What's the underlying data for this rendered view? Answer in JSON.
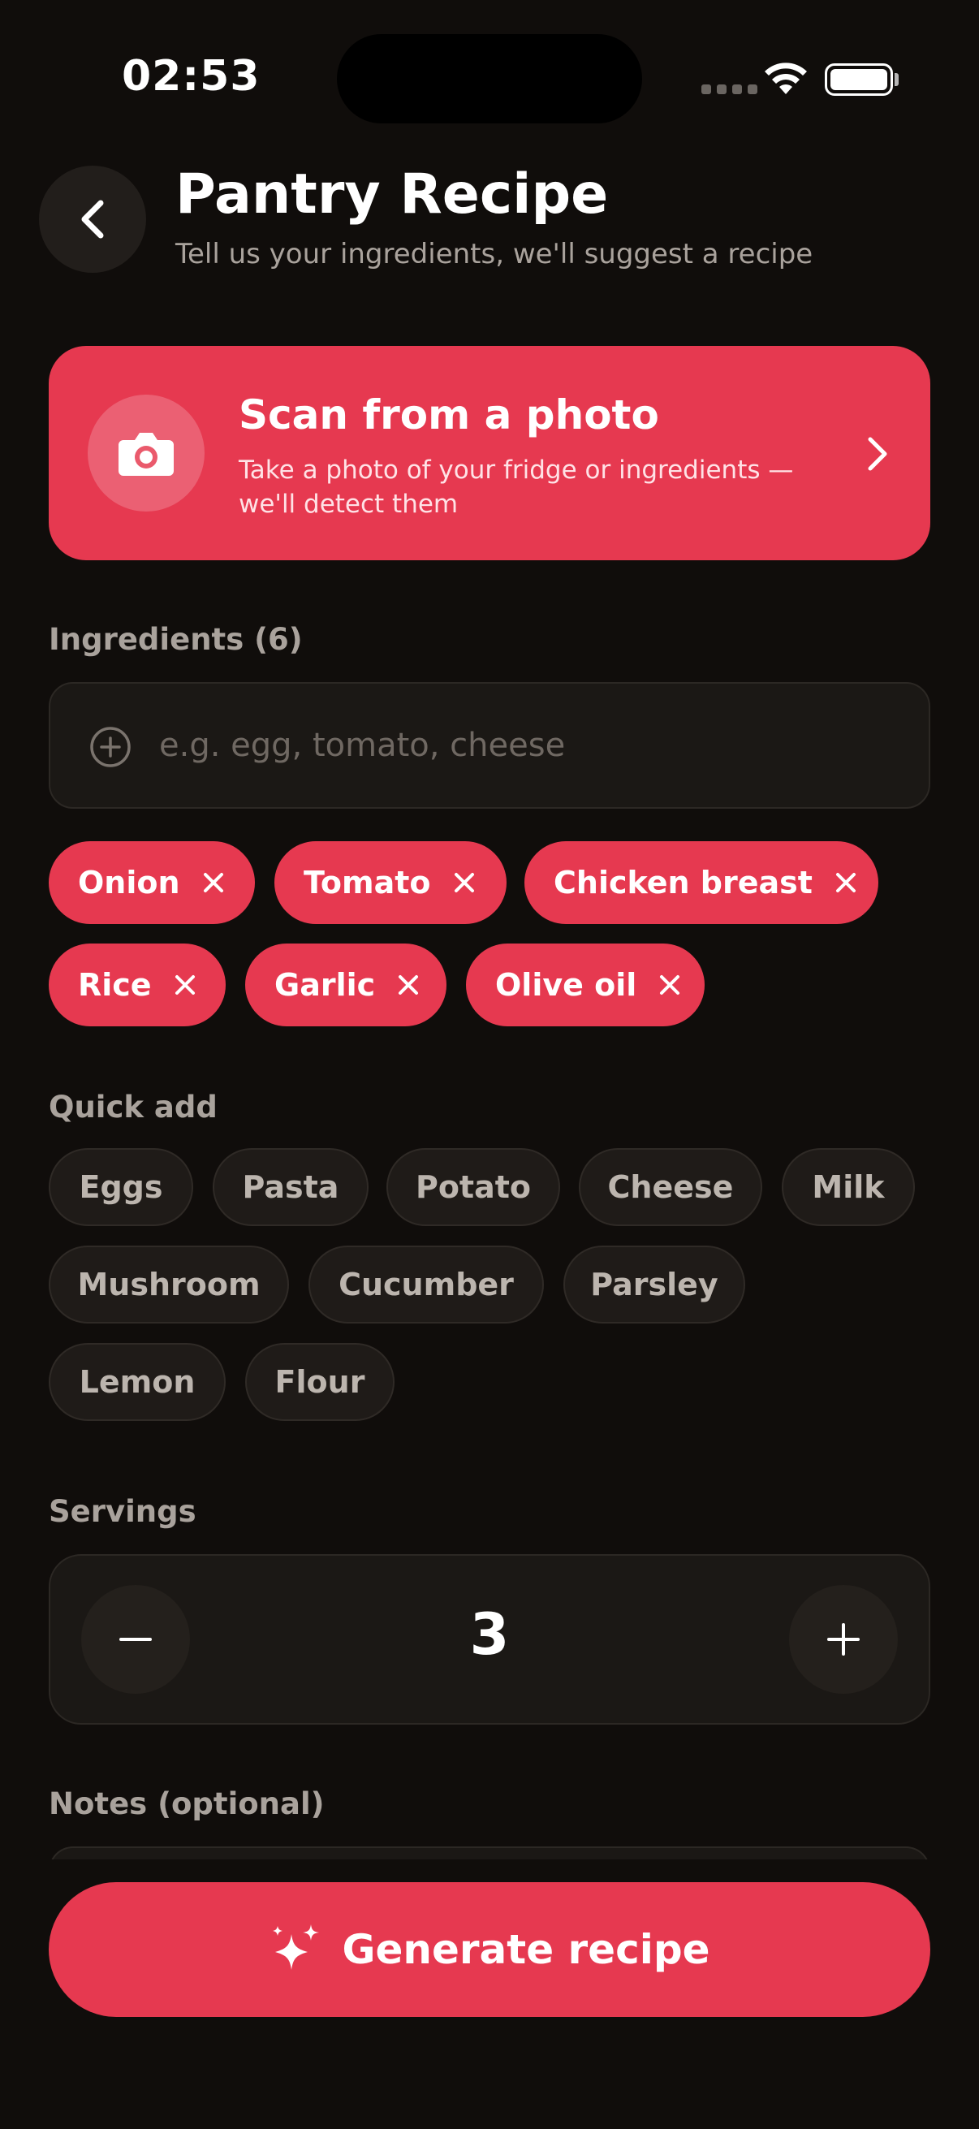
{
  "status_bar": {
    "time": "02:53"
  },
  "header": {
    "title": "Pantry Recipe",
    "subtitle": "Tell us your ingredients, we'll suggest a recipe"
  },
  "scan_card": {
    "title": "Scan from a photo",
    "description": "Take a photo of your fridge or ingredients — we'll detect them"
  },
  "ingredients": {
    "label": "Ingredients (6)",
    "placeholder": "e.g. egg, tomato, cheese",
    "items": [
      "Onion",
      "Tomato",
      "Chicken breast",
      "Rice",
      "Garlic",
      "Olive oil"
    ]
  },
  "quick_add": {
    "label": "Quick add",
    "items": [
      "Eggs",
      "Pasta",
      "Potato",
      "Cheese",
      "Milk",
      "Mushroom",
      "Cucumber",
      "Parsley",
      "Lemon",
      "Flour"
    ]
  },
  "servings": {
    "label": "Servings",
    "value": "3"
  },
  "notes": {
    "label": "Notes (optional)"
  },
  "generate_button": {
    "label": "Generate recipe"
  },
  "colors": {
    "accent": "#e63950",
    "background": "#100d0b",
    "surface": "#1b1815",
    "muted_text": "#a9a29c"
  }
}
